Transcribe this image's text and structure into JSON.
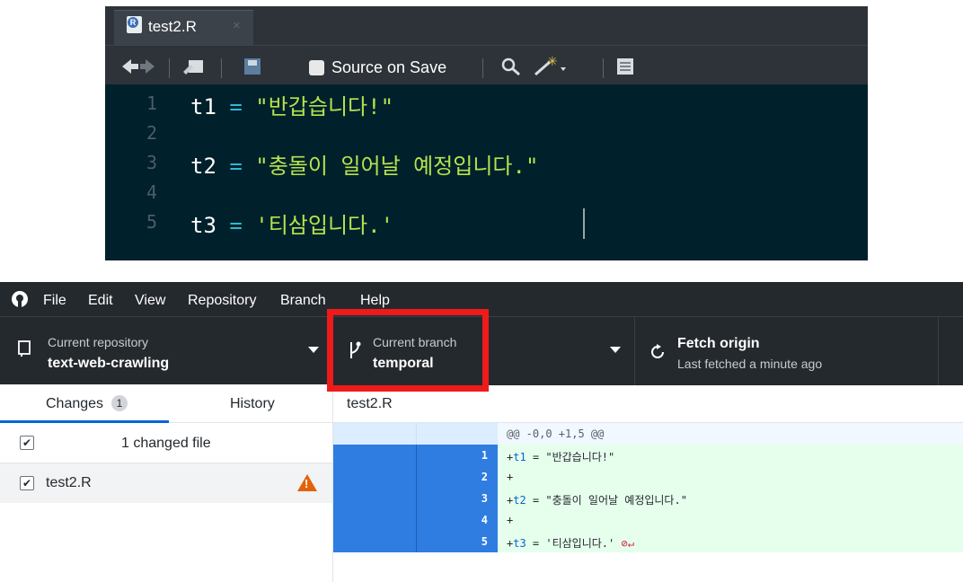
{
  "editor": {
    "tab_title": "test2.R",
    "tab_close": "×",
    "file_badge": "R",
    "source_on_save": "Source on Save",
    "lines": [
      {
        "num": "1",
        "var": "t1",
        "op": "=",
        "str": "\"반갑습니다!\""
      },
      {
        "num": "2",
        "var": "",
        "op": "",
        "str": ""
      },
      {
        "num": "3",
        "var": "t2",
        "op": "=",
        "str": "\"충돌이 일어날 예정입니다.\""
      },
      {
        "num": "4",
        "var": "",
        "op": "",
        "str": ""
      },
      {
        "num": "5",
        "var": "t3",
        "op": "=",
        "str": "'티삼입니다.'"
      }
    ]
  },
  "github": {
    "menu": [
      "File",
      "Edit",
      "View",
      "Repository",
      "Branch",
      "Help"
    ],
    "repo_label": "Current repository",
    "repo_name": "text-web-crawling",
    "branch_label": "Current branch",
    "branch_name": "temporal",
    "fetch_label": "Fetch origin",
    "fetch_sub": "Last fetched a minute ago",
    "tab_changes": "Changes",
    "changes_count": "1",
    "tab_history": "History",
    "changed_files": "1 changed file",
    "file_name": "test2.R",
    "diff_file": "test2.R",
    "hunk_header": "@@ -0,0 +1,5 @@",
    "diff_lines": [
      {
        "num": "1",
        "prefix": "+",
        "var": "t1",
        "rest": " = \"반갑습니다!\""
      },
      {
        "num": "2",
        "prefix": "+",
        "var": "",
        "rest": ""
      },
      {
        "num": "3",
        "prefix": "+",
        "var": "t2",
        "rest": " = \"충돌이 일어날 예정입니다.\""
      },
      {
        "num": "4",
        "prefix": "+",
        "var": "",
        "rest": ""
      },
      {
        "num": "5",
        "prefix": "+",
        "var": "t3",
        "rest": " = '티삼입니다.'"
      }
    ],
    "highlight_color": "#ef1b1b"
  }
}
